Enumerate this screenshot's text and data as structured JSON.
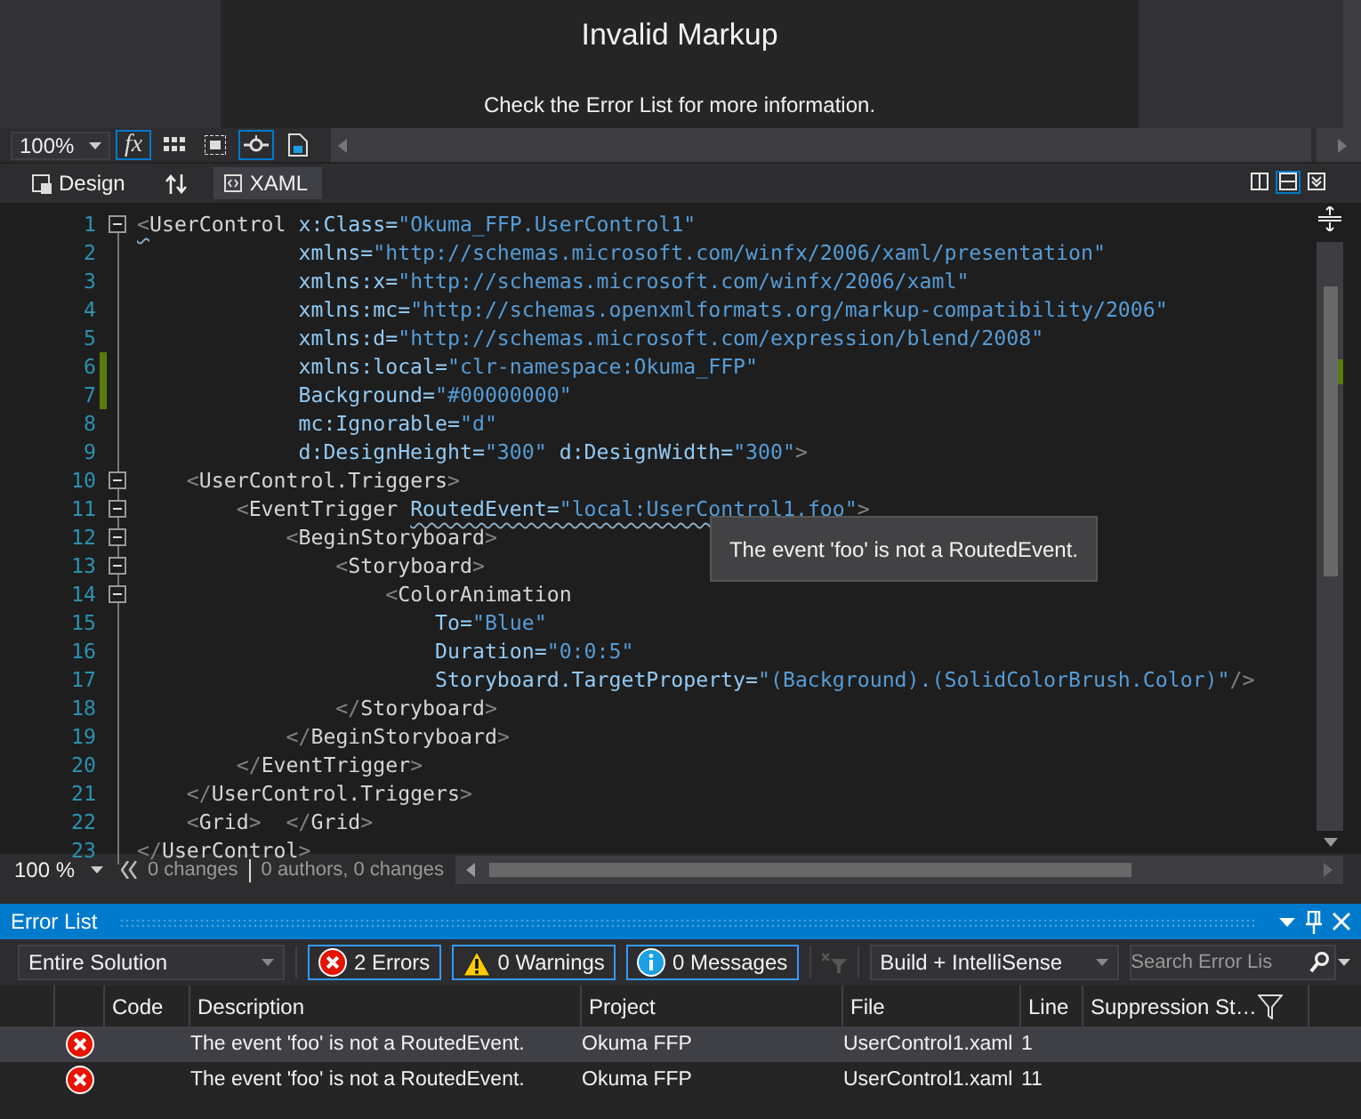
{
  "designer": {
    "title": "Invalid Markup",
    "message": "Check the Error List for more information."
  },
  "design_toolbar": {
    "zoom": "100%",
    "tools": [
      {
        "kind": "text",
        "label": "fx",
        "selected": true
      },
      {
        "kind": "grid",
        "selected": false
      },
      {
        "kind": "effects",
        "selected": false
      },
      {
        "kind": "snap",
        "selected": true
      },
      {
        "kind": "template",
        "selected": false
      }
    ]
  },
  "view_tabs": [
    {
      "label": "Design",
      "selected": false
    },
    {
      "label": "XAML",
      "selected": true
    }
  ],
  "layout_buttons": [
    {
      "kind": "vertical",
      "selected": false
    },
    {
      "kind": "horizontal",
      "selected": true
    },
    {
      "kind": "collapse",
      "selected": false
    }
  ],
  "editor": {
    "tooltip": "The event 'foo' is not a RoutedEvent.",
    "lines": [
      {
        "number": "1",
        "foldable": true,
        "changed": false,
        "tokens": [
          {
            "kind": "error-punct",
            "text": "<"
          },
          {
            "kind": "tag",
            "text": "UserControl "
          },
          {
            "kind": "attr",
            "text": "x:Class="
          },
          {
            "kind": "value",
            "text": "\"Okuma_FFP.UserControl1\""
          }
        ]
      },
      {
        "number": "2",
        "foldable": false,
        "changed": false,
        "tokens": [
          {
            "kind": "attr",
            "text": "             xmlns="
          },
          {
            "kind": "value",
            "text": "\"http://schemas.microsoft.com/winfx/2006/xaml/presentation\""
          }
        ]
      },
      {
        "number": "3",
        "foldable": false,
        "changed": false,
        "tokens": [
          {
            "kind": "attr",
            "text": "             xmlns:x="
          },
          {
            "kind": "value",
            "text": "\"http://schemas.microsoft.com/winfx/2006/xaml\""
          }
        ]
      },
      {
        "number": "4",
        "foldable": false,
        "changed": false,
        "tokens": [
          {
            "kind": "attr",
            "text": "             xmlns:mc="
          },
          {
            "kind": "value",
            "text": "\"http://schemas.openxmlformats.org/markup-compatibility/2006\""
          }
        ]
      },
      {
        "number": "5",
        "foldable": false,
        "changed": false,
        "tokens": [
          {
            "kind": "attr",
            "text": "             xmlns:d="
          },
          {
            "kind": "value",
            "text": "\"http://schemas.microsoft.com/expression/blend/2008\""
          }
        ]
      },
      {
        "number": "6",
        "foldable": false,
        "changed": true,
        "tokens": [
          {
            "kind": "attr",
            "text": "             xmlns:local="
          },
          {
            "kind": "value",
            "text": "\"clr-namespace:Okuma_FFP\""
          }
        ]
      },
      {
        "number": "7",
        "foldable": false,
        "changed": true,
        "tokens": [
          {
            "kind": "attr",
            "text": "             Background="
          },
          {
            "kind": "value",
            "text": "\"#00000000\""
          }
        ]
      },
      {
        "number": "8",
        "foldable": false,
        "changed": false,
        "tokens": [
          {
            "kind": "attr",
            "text": "             mc:Ignorable="
          },
          {
            "kind": "value",
            "text": "\"d\""
          }
        ]
      },
      {
        "number": "9",
        "foldable": false,
        "changed": false,
        "tokens": [
          {
            "kind": "attr",
            "text": "             d:DesignHeight="
          },
          {
            "kind": "value",
            "text": "\"300\""
          },
          {
            "kind": "attr",
            "text": " d:DesignWidth="
          },
          {
            "kind": "value",
            "text": "\"300\""
          },
          {
            "kind": "punct",
            "text": ">"
          }
        ]
      },
      {
        "number": "10",
        "foldable": true,
        "changed": false,
        "tokens": [
          {
            "kind": "punct",
            "text": "    <"
          },
          {
            "kind": "tag",
            "text": "UserControl.Triggers"
          },
          {
            "kind": "punct",
            "text": ">"
          }
        ]
      },
      {
        "number": "11",
        "foldable": true,
        "changed": false,
        "tokens": [
          {
            "kind": "punct",
            "text": "        <"
          },
          {
            "kind": "tag",
            "text": "EventTrigger "
          },
          {
            "kind": "error-attr",
            "text": "RoutedEvent="
          },
          {
            "kind": "error-value",
            "text": "\"local:UserControl1.foo\""
          },
          {
            "kind": "punct",
            "text": ">"
          }
        ]
      },
      {
        "number": "12",
        "foldable": true,
        "changed": false,
        "tokens": [
          {
            "kind": "punct",
            "text": "            <"
          },
          {
            "kind": "tag",
            "text": "BeginStoryboard"
          },
          {
            "kind": "punct",
            "text": ">"
          }
        ]
      },
      {
        "number": "13",
        "foldable": true,
        "changed": false,
        "tokens": [
          {
            "kind": "punct",
            "text": "                <"
          },
          {
            "kind": "tag",
            "text": "Storyboard"
          },
          {
            "kind": "punct",
            "text": ">"
          }
        ]
      },
      {
        "number": "14",
        "foldable": true,
        "changed": false,
        "tokens": [
          {
            "kind": "punct",
            "text": "                    <"
          },
          {
            "kind": "tag",
            "text": "ColorAnimation"
          }
        ]
      },
      {
        "number": "15",
        "foldable": false,
        "changed": false,
        "tokens": [
          {
            "kind": "attr",
            "text": "                        To="
          },
          {
            "kind": "value",
            "text": "\"Blue\""
          }
        ]
      },
      {
        "number": "16",
        "foldable": false,
        "changed": false,
        "tokens": [
          {
            "kind": "attr",
            "text": "                        Duration="
          },
          {
            "kind": "value",
            "text": "\"0:0:5\""
          }
        ]
      },
      {
        "number": "17",
        "foldable": false,
        "changed": false,
        "tokens": [
          {
            "kind": "attr",
            "text": "                        Storyboard.TargetProperty="
          },
          {
            "kind": "value",
            "text": "\"(Background).(SolidColorBrush.Color)\""
          },
          {
            "kind": "punct",
            "text": "/>"
          }
        ]
      },
      {
        "number": "18",
        "foldable": false,
        "changed": false,
        "tokens": [
          {
            "kind": "punct",
            "text": "                </"
          },
          {
            "kind": "tag",
            "text": "Storyboard"
          },
          {
            "kind": "punct",
            "text": ">"
          }
        ]
      },
      {
        "number": "19",
        "foldable": false,
        "changed": false,
        "tokens": [
          {
            "kind": "punct",
            "text": "            </"
          },
          {
            "kind": "tag",
            "text": "BeginStoryboard"
          },
          {
            "kind": "punct",
            "text": ">"
          }
        ]
      },
      {
        "number": "20",
        "foldable": false,
        "changed": false,
        "tokens": [
          {
            "kind": "punct",
            "text": "        </"
          },
          {
            "kind": "tag",
            "text": "EventTrigger"
          },
          {
            "kind": "punct",
            "text": ">"
          }
        ]
      },
      {
        "number": "21",
        "foldable": false,
        "changed": false,
        "tokens": [
          {
            "kind": "punct",
            "text": "    </"
          },
          {
            "kind": "tag",
            "text": "UserControl.Triggers"
          },
          {
            "kind": "punct",
            "text": ">"
          }
        ]
      },
      {
        "number": "22",
        "foldable": false,
        "changed": false,
        "tokens": [
          {
            "kind": "punct",
            "text": "    <"
          },
          {
            "kind": "tag",
            "text": "Grid"
          },
          {
            "kind": "punct",
            "text": ">  </"
          },
          {
            "kind": "tag",
            "text": "Grid"
          },
          {
            "kind": "punct",
            "text": ">"
          }
        ]
      },
      {
        "number": "23",
        "foldable": false,
        "changed": false,
        "tokens": [
          {
            "kind": "punct",
            "text": "</"
          },
          {
            "kind": "tag",
            "text": "UserControl"
          },
          {
            "kind": "punct",
            "text": ">"
          }
        ]
      }
    ]
  },
  "editor_status": {
    "zoom": "100 %",
    "changes": "0 changes",
    "authors": "0 authors, 0 changes"
  },
  "error_list": {
    "title": "Error List",
    "scope": "Entire Solution",
    "filters": [
      {
        "kind": "error",
        "label": "2 Errors",
        "selected": true
      },
      {
        "kind": "warning",
        "label": "0 Warnings",
        "selected": true
      },
      {
        "kind": "message",
        "label": "0 Messages",
        "selected": true
      }
    ],
    "source": "Build + IntelliSense",
    "search": {
      "placeholder": "Search Error Lis"
    },
    "columns": [
      "Code",
      "Description",
      "Project",
      "File",
      "Line",
      "Suppression St…"
    ],
    "rows": [
      {
        "kind": "error",
        "selected": true,
        "description": "The event 'foo' is not a RoutedEvent.",
        "project": "Okuma FFP",
        "file": "UserControl1.xaml",
        "line": "1"
      },
      {
        "kind": "error",
        "selected": false,
        "description": "The event 'foo' is not a RoutedEvent.",
        "project": "Okuma FFP",
        "file": "UserControl1.xaml",
        "line": "11"
      }
    ]
  }
}
